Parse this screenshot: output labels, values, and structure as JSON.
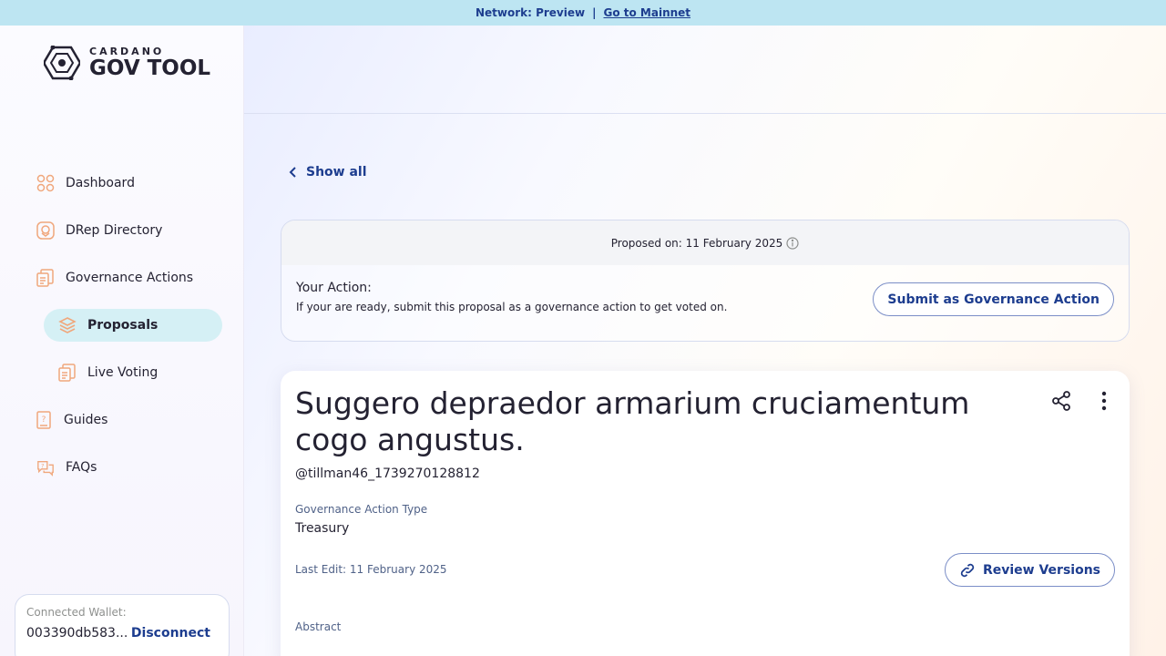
{
  "banner": {
    "network_text": "Network: Preview",
    "separator": "|",
    "link_text": "Go to Mainnet"
  },
  "logo": {
    "small": "CARDANO",
    "big": "GOV TOOL"
  },
  "sidebar": {
    "items": [
      {
        "label": "Dashboard",
        "icon": "dashboard-icon"
      },
      {
        "label": "DRep Directory",
        "icon": "drep-icon"
      },
      {
        "label": "Governance Actions",
        "icon": "governance-icon"
      },
      {
        "label": "Proposals",
        "icon": "proposals-icon"
      },
      {
        "label": "Live Voting",
        "icon": "live-voting-icon"
      },
      {
        "label": "Guides",
        "icon": "guides-icon"
      },
      {
        "label": "FAQs",
        "icon": "faqs-icon"
      }
    ]
  },
  "wallet": {
    "label": "Connected Wallet:",
    "address": "003390db583...",
    "disconnect": "Disconnect"
  },
  "nav": {
    "show_all": "Show all"
  },
  "action_card": {
    "proposed_on": "Proposed on: 11 February 2025",
    "title": "Your Action:",
    "description": "If your are ready, submit this proposal as a governance action to get voted on.",
    "submit_label": "Submit as Governance Action"
  },
  "proposal": {
    "title": "Suggero depraedor armarium cruciamentum cogo angustus.",
    "author": "@tillman46_1739270128812",
    "type_label": "Governance Action Type",
    "type_value": "Treasury",
    "last_edit": "Last Edit: 11 February 2025",
    "review_label": "Review Versions",
    "abstract_label": "Abstract"
  },
  "colors": {
    "accent": "#1d3d8f",
    "icon_orange": "#f0a77c",
    "active_bg": "#d5f0f5",
    "banner_bg": "#bde5f2"
  }
}
